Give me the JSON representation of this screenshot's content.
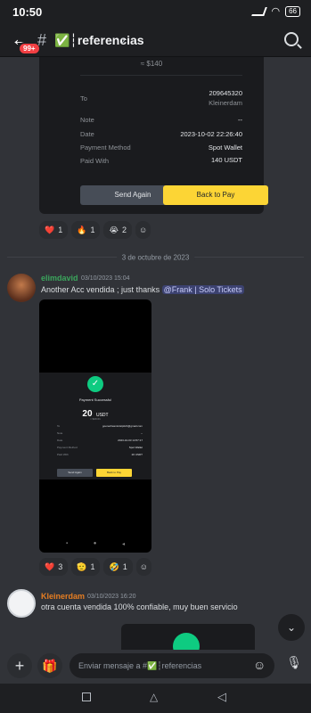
{
  "status_bar": {
    "time": "10:50",
    "battery": "66"
  },
  "header": {
    "badge": "99+",
    "channel": "✅┆referencias",
    "chevron": "›"
  },
  "receipt_top": {
    "amount_line": "≈ $140",
    "rows": [
      {
        "label": "To",
        "value": "209645320",
        "value2": "Kleinerdam"
      },
      {
        "label": "Note",
        "value": "--"
      },
      {
        "label": "Date",
        "value": "2023-10-02 22:26:40"
      },
      {
        "label": "Payment Method",
        "value": "Spot Wallet"
      },
      {
        "label": "Paid With",
        "value": "140 USDT"
      }
    ],
    "send_again": "Send Again",
    "back_to_pay": "Back to Pay"
  },
  "reactions_1": [
    {
      "emoji": "❤️",
      "count": "1"
    },
    {
      "emoji": "🔥",
      "count": "1"
    },
    {
      "emoji": "😭",
      "count": "2"
    }
  ],
  "date_divider": "3 de octubre de 2023",
  "message_1": {
    "username": "elimdavid",
    "timestamp": "03/10/2023 15:04",
    "text": "Another Acc vendida ; just thanks ",
    "mention": "@Frank | Solo Tickets"
  },
  "receipt_small": {
    "title": "Payment Successful",
    "amount": "20",
    "unit": "USDT",
    "approx": "≈ $20.01",
    "rows": [
      {
        "label": "To",
        "value": "goonerhasministpitch@gmail.com"
      },
      {
        "label": "Note",
        "value": "--"
      },
      {
        "label": "Date",
        "value": "2023-10-03 14:57:17"
      },
      {
        "label": "Payment Method",
        "value": "Spot Wallet"
      },
      {
        "label": "Paid With",
        "value": "20 USDT"
      }
    ],
    "send_again": "Send Again",
    "back_to_pay": "Back to Pay"
  },
  "reactions_2": [
    {
      "emoji": "❤️",
      "count": "3"
    },
    {
      "emoji": "🫡",
      "count": "1"
    },
    {
      "emoji": "🤣",
      "count": "1"
    }
  ],
  "message_2": {
    "username": "Kleinerdam",
    "timestamp": "03/10/2023 16:20",
    "text": "otra cuenta vendida 100% confiable, muy buen servicio"
  },
  "composer": {
    "placeholder": "Enviar mensaje a #✅┆referencias"
  },
  "colors": {
    "accent_yellow": "#fcd535",
    "user1": "#3ba55c",
    "user2": "#e67e22",
    "mention_bg": "#3c4270"
  }
}
